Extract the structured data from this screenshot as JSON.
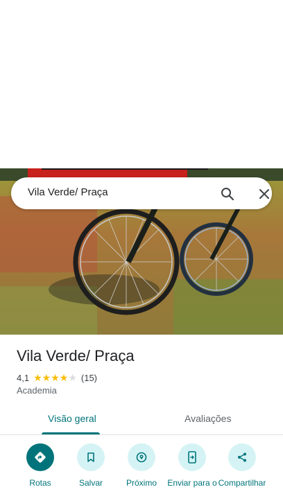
{
  "search": {
    "query": "Vila Verde/ Praça",
    "search_icon": "search-icon",
    "close_icon": "close-icon"
  },
  "place": {
    "title": "Vila Verde/ Praça",
    "rating": "4,1",
    "rating_fraction": 0.82,
    "stars_filled": 4,
    "stars_total": 5,
    "review_count": "(15)",
    "category": "Academia"
  },
  "tabs": [
    {
      "label": "Visão geral",
      "active": true
    },
    {
      "label": "Avaliações",
      "active": false
    }
  ],
  "actions": [
    {
      "label": "Rotas",
      "icon": "directions-icon"
    },
    {
      "label": "Salvar",
      "icon": "bookmark-icon"
    },
    {
      "label": "Próximo",
      "icon": "nearby-icon"
    },
    {
      "label": "Enviar para o",
      "icon": "send-to-phone-icon"
    },
    {
      "label": "Compartilhar",
      "icon": "share-icon"
    }
  ],
  "colors": {
    "accent": "#00747a",
    "accent_light": "#d5f3f5",
    "star": "#fbbc04",
    "text": "#202124"
  }
}
